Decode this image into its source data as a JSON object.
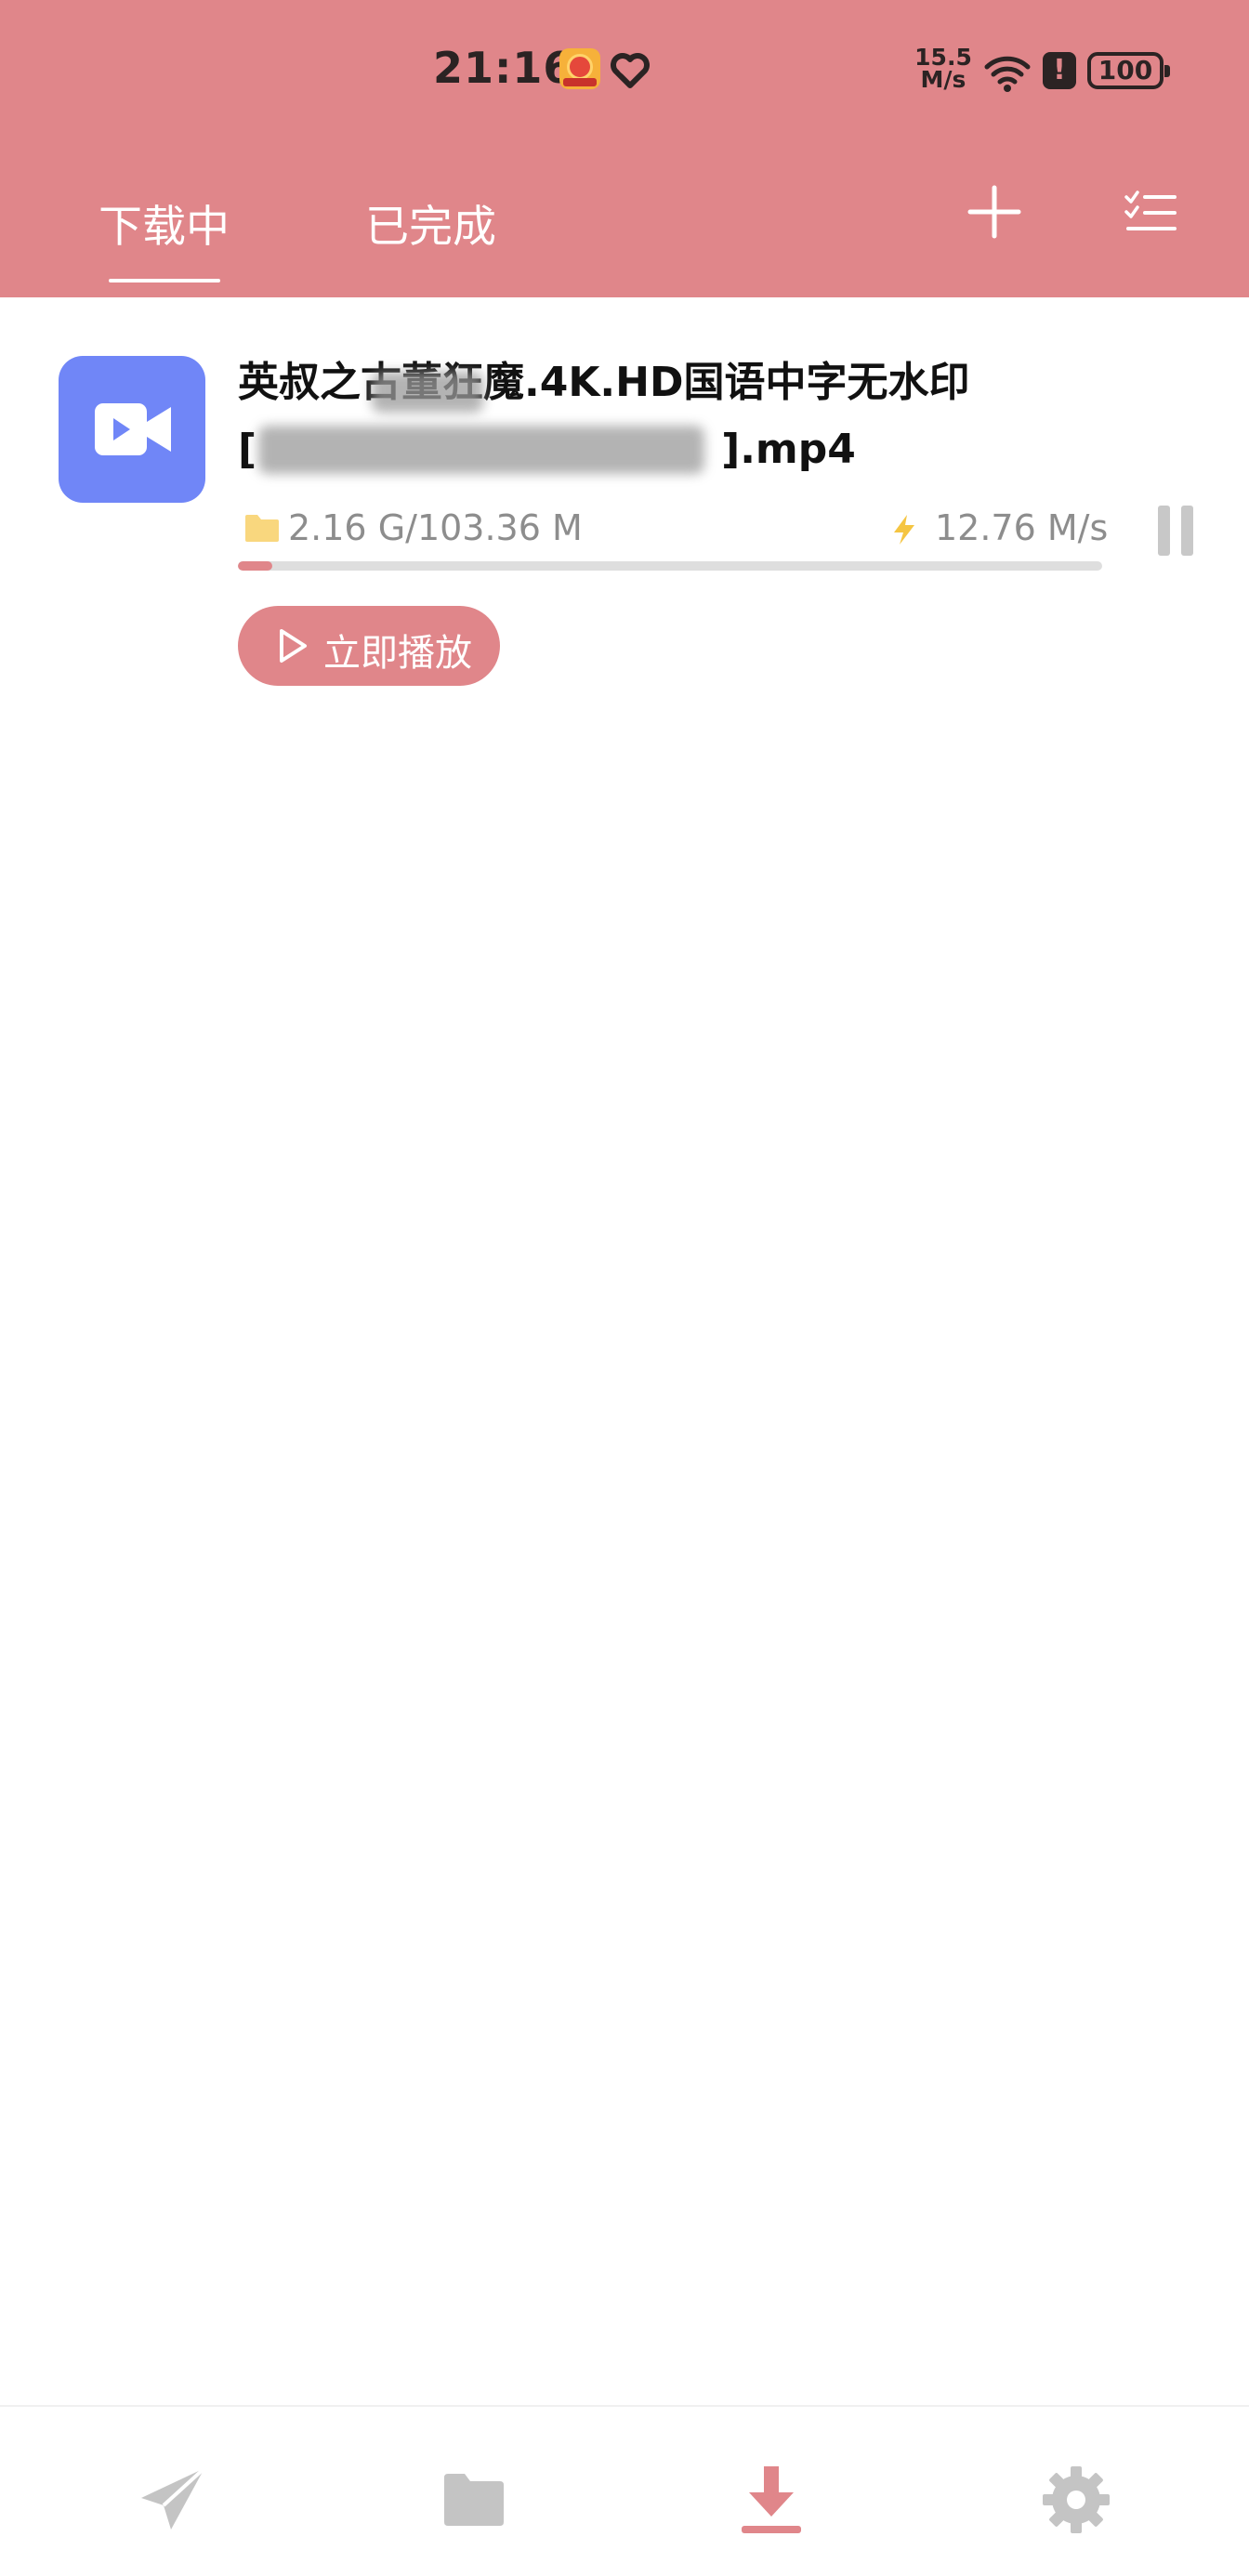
{
  "status_bar": {
    "time": "21:16",
    "network_speed_value": "15.5",
    "network_speed_unit": "M/s",
    "alert_symbol": "!",
    "battery": "100"
  },
  "tabs": [
    {
      "label": "下载中",
      "active": true
    },
    {
      "label": "已完成",
      "active": false
    }
  ],
  "header_icons": [
    "add-icon",
    "checklist-icon"
  ],
  "download": {
    "file_name_line1": "英叔之古董狂魔.4K.HD国语中字无水印",
    "file_name_line2_prefix": "[",
    "file_name_line2_suffix": "].mp4",
    "file_type_icon": "video-camera-icon",
    "size": "2.16 G/103.36 M",
    "speed": "12.76 M/s",
    "progress": 0.04,
    "play_label": "立即播放"
  },
  "bottom_nav": [
    {
      "icon": "send-icon",
      "active": false
    },
    {
      "icon": "folder-icon",
      "active": false
    },
    {
      "icon": "download-icon",
      "active": true
    },
    {
      "icon": "settings-icon",
      "active": false
    }
  ],
  "colors": {
    "accent": "#e0868a",
    "thumb": "#7086f7",
    "nav_inactive": "#c4c4c4",
    "bolt": "#f5c542",
    "folder": "#f9d77e"
  }
}
